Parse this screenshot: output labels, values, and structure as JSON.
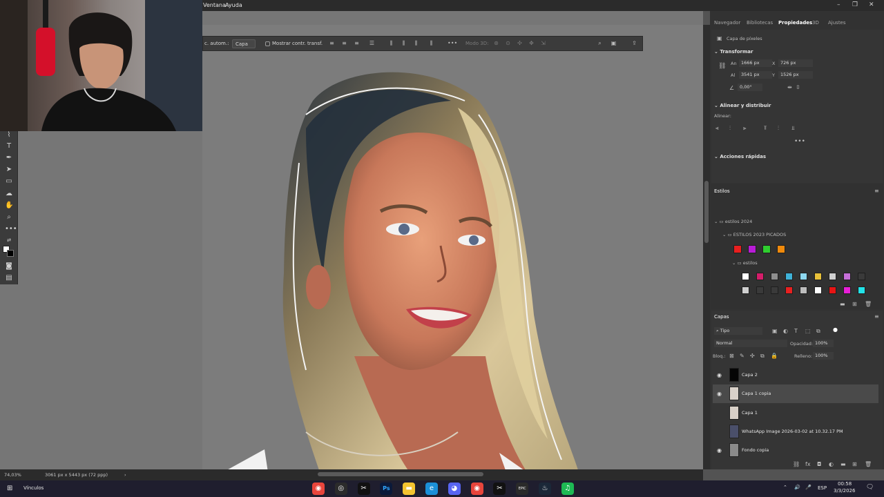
{
  "menubar": {
    "items": [
      "Ventana",
      "Ayuda"
    ],
    "controls": [
      "–",
      "❐",
      "✕"
    ]
  },
  "options_bar": {
    "auto_select_label": "c. autom.:",
    "layer_select": "Capa",
    "show_transform_label": "Mostrar contr. transf.",
    "mode_3d_label": "Modo 3D:"
  },
  "dock": {
    "tabs": [
      "Navegador",
      "Bibliotecas",
      "Propiedades",
      "3D",
      "Ajustes"
    ],
    "active_tab": "Propiedades",
    "properties": {
      "kind": "Capa de píxeles",
      "transform_title": "Transformar",
      "width_label": "An",
      "width": "1666 px",
      "height_label": "Al",
      "height": "3541 px",
      "x_label": "X",
      "x": "726 px",
      "y_label": "Y",
      "y": "1526 px",
      "angle": "0,00°",
      "align_title": "Alinear y distribuir",
      "align_label": "Alinear:",
      "quick_actions_title": "Acciones rápidas"
    },
    "styles": {
      "title": "Estilos",
      "group1": "estilos 2024",
      "group2": "ESTILOS 2023 PICADOS",
      "group3": "estilos",
      "swatch_colors": [
        "#e81f1f",
        "#b81cd6",
        "#2fce2f",
        "#f08a0c"
      ],
      "style_colors_row1": [
        "#ffffff",
        "#d41d6a",
        "#8e8e8e",
        "#3fb2d8",
        "#8ed8f0",
        "#e8c13a",
        "#cfcfcf",
        "#c66fd8",
        "#3a3a3a"
      ],
      "style_colors_row2": [
        "#cfcfcf",
        "#3a3a3a",
        "#3a3a3a",
        "#e82020",
        "#bdbdbd",
        "#ffffff",
        "#e81414",
        "#e81fd8",
        "#22e3e8"
      ]
    },
    "layers": {
      "title": "Capas",
      "filter_kind": "Tipo",
      "blend_mode": "Normal",
      "opacity_label": "Opacidad:",
      "opacity": "100%",
      "lock_label": "Bloq.:",
      "fill_label": "Relleno:",
      "fill": "100%",
      "items": [
        {
          "name": "Capa 2",
          "visible": true,
          "selected": false,
          "thumb": "#050505"
        },
        {
          "name": "Capa 1 copia",
          "visible": true,
          "selected": true,
          "thumb": "#d8d0c8"
        },
        {
          "name": "Capa 1",
          "visible": false,
          "selected": false,
          "thumb": "#d8d0c8"
        },
        {
          "name": "WhatsApp Image 2026-03-02 at 10.32.17 PM",
          "visible": false,
          "selected": false,
          "thumb": "#4a4f6a"
        },
        {
          "name": "Fondo copia",
          "visible": true,
          "selected": false,
          "thumb": "#8a8a8a"
        }
      ]
    }
  },
  "status": {
    "zoom": "74,03%",
    "doc_size": "3061 px x 5443 px (72 ppp)"
  },
  "taskbar": {
    "left_label": "Vínculos",
    "language": "ESP",
    "time": "00:58",
    "date": "3/3/2026",
    "apps": [
      {
        "name": "chrome",
        "color": "#e8453c",
        "glyph": "◉"
      },
      {
        "name": "obs",
        "color": "#2b2b2b",
        "glyph": "◎"
      },
      {
        "name": "capcut",
        "color": "#111111",
        "glyph": "✂"
      },
      {
        "name": "photoshop",
        "color": "#0b1a3a",
        "glyph": "Ps"
      },
      {
        "name": "files",
        "color": "#f4c430",
        "glyph": "▬"
      },
      {
        "name": "edge",
        "color": "#1b8fd8",
        "glyph": "e"
      },
      {
        "name": "discord",
        "color": "#5865f2",
        "glyph": "◕"
      },
      {
        "name": "chrome2",
        "color": "#e8453c",
        "glyph": "◉"
      },
      {
        "name": "capcut2",
        "color": "#111111",
        "glyph": "✂"
      },
      {
        "name": "epic",
        "color": "#2a2a2a",
        "glyph": "EPIC"
      },
      {
        "name": "steam",
        "color": "#1b2838",
        "glyph": "♨"
      },
      {
        "name": "spotify",
        "color": "#1db954",
        "glyph": "♫"
      }
    ]
  }
}
